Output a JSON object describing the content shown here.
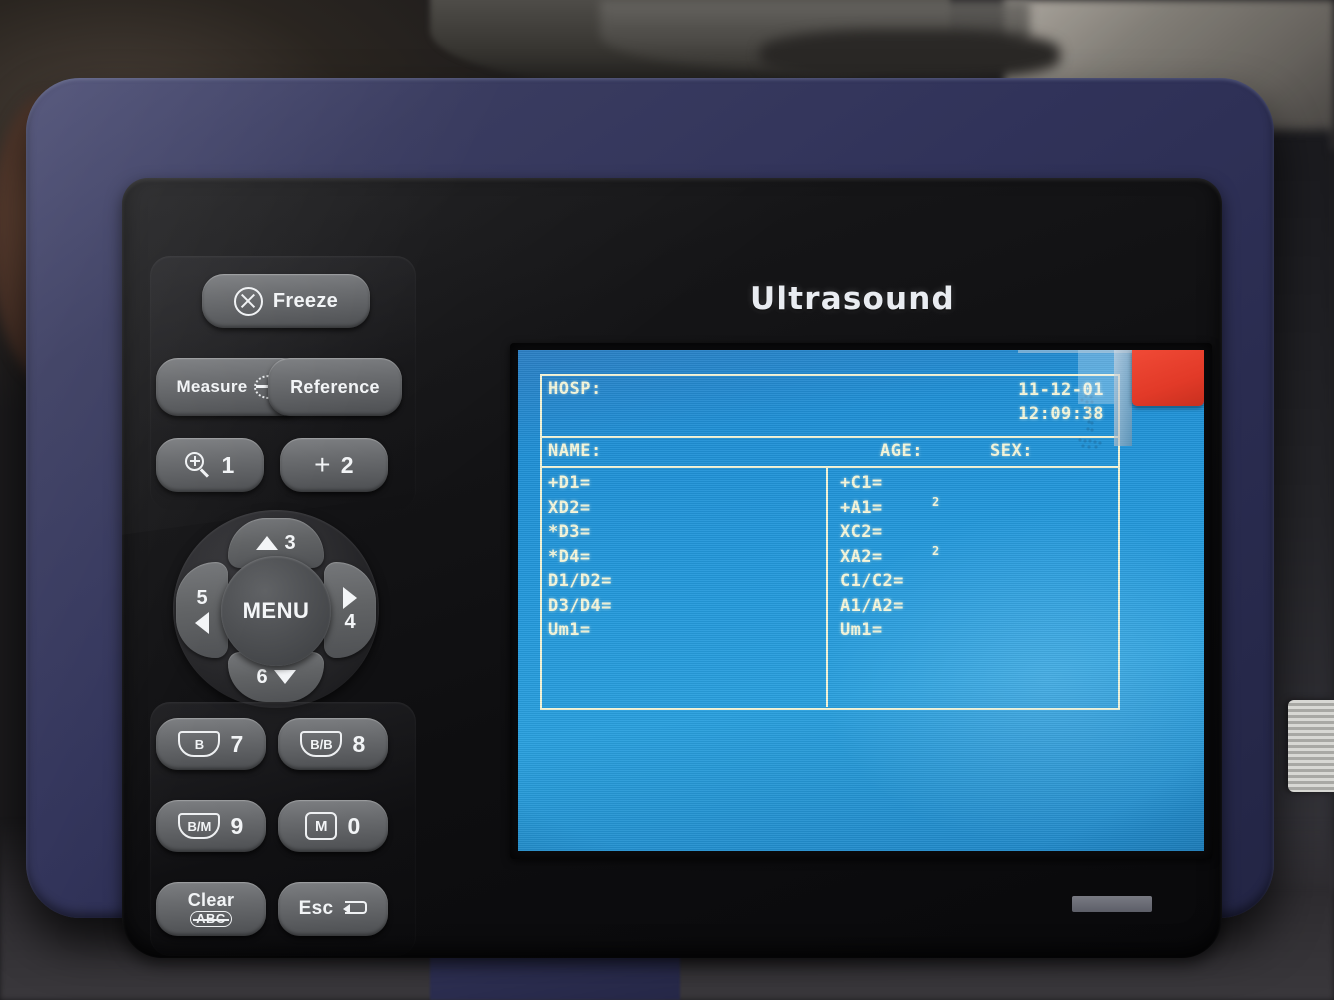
{
  "device": {
    "brand_title": "Ultrasound",
    "case_color": "#31335a",
    "face_color": "#121214",
    "key_color": "#6a6c6f",
    "accent_red": "#e23a28"
  },
  "keypad": {
    "freeze": {
      "label": "Freeze",
      "icon": "freeze-icon"
    },
    "measure": {
      "label": "Measure",
      "icon": "caliper-icon"
    },
    "reference": {
      "label": "Reference"
    },
    "zoom1": {
      "number": "1",
      "icon": "zoom-in-icon"
    },
    "plus2": {
      "number": "2",
      "icon": "plus-icon"
    },
    "b7": {
      "mode": "B",
      "number": "7",
      "icon": "probe-sector-icon"
    },
    "bb8": {
      "mode": "B/B",
      "number": "8",
      "icon": "probe-sector-icon"
    },
    "bm9": {
      "mode": "B/M",
      "number": "9",
      "icon": "probe-sector-icon"
    },
    "m0": {
      "mode": "M",
      "number": "0",
      "icon": "m-mode-icon"
    },
    "clear": {
      "line1": "Clear",
      "line2": "ABC"
    },
    "esc": {
      "label": "Esc",
      "icon": "enter-arrow-icon"
    }
  },
  "dpad": {
    "center_label": "MENU",
    "up": "3",
    "right": "4",
    "left": "5",
    "down": "6"
  },
  "screen": {
    "report": {
      "hosp_label": "HOSP:",
      "date": "11-12-01",
      "time": "12:09:38",
      "name_label": "NAME:",
      "age_label": "AGE:",
      "sex_label": "SEX:",
      "left_column": [
        {
          "label": "+D1=",
          "value": ""
        },
        {
          "label": "XD2=",
          "value": ""
        },
        {
          "label": "*D3=",
          "value": ""
        },
        {
          "label": "*D4=",
          "value": ""
        },
        {
          "label": "D1/D2=",
          "value": ""
        },
        {
          "label": "D3/D4=",
          "value": ""
        },
        {
          "label": "Um1=",
          "value": ""
        }
      ],
      "right_column": [
        {
          "label": "+C1=",
          "value": ""
        },
        {
          "label": "+A1=",
          "value": "2"
        },
        {
          "label": "XC2=",
          "value": ""
        },
        {
          "label": "XA2=",
          "value": "2"
        },
        {
          "label": "C1/C2=",
          "value": ""
        },
        {
          "label": "A1/A2=",
          "value": ""
        },
        {
          "label": "Um1=",
          "value": ""
        }
      ]
    },
    "overlay": {
      "film_pull_tab": "protective-film-pull-tab",
      "film_watermark": "1"
    }
  }
}
